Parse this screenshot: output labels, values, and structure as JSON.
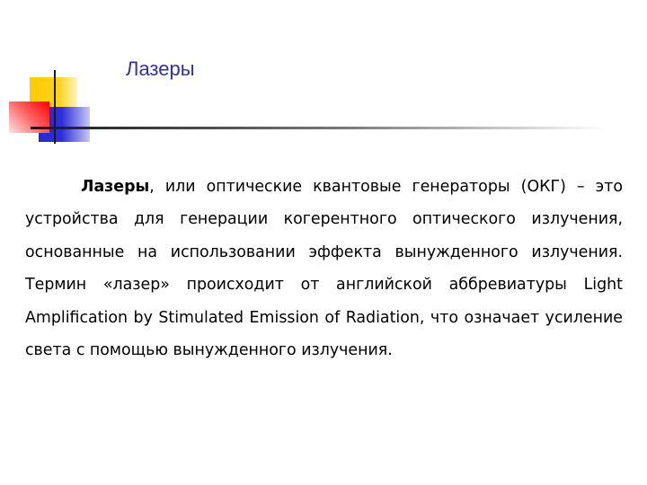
{
  "slide": {
    "title": "Лазеры",
    "paragraph": {
      "bold_term": "Лазеры",
      "text": ", или оптические квантовые генераторы (ОКГ) – это устройства для генерации когерентного оптического излучения, основанные на использовании эффекта вынужденного излучения. Термин «лазер» происходит от английской аббревиатуры Light Amplification by Stimulated Emission of Radiation, что означает усиление света с помощью вынужденного излучения."
    }
  },
  "colors": {
    "title": "#333399",
    "logo_yellow": "#ffcc00",
    "logo_red": "#ff0000",
    "logo_blue": "#2a2ad0",
    "line": "#1a1a1a"
  }
}
